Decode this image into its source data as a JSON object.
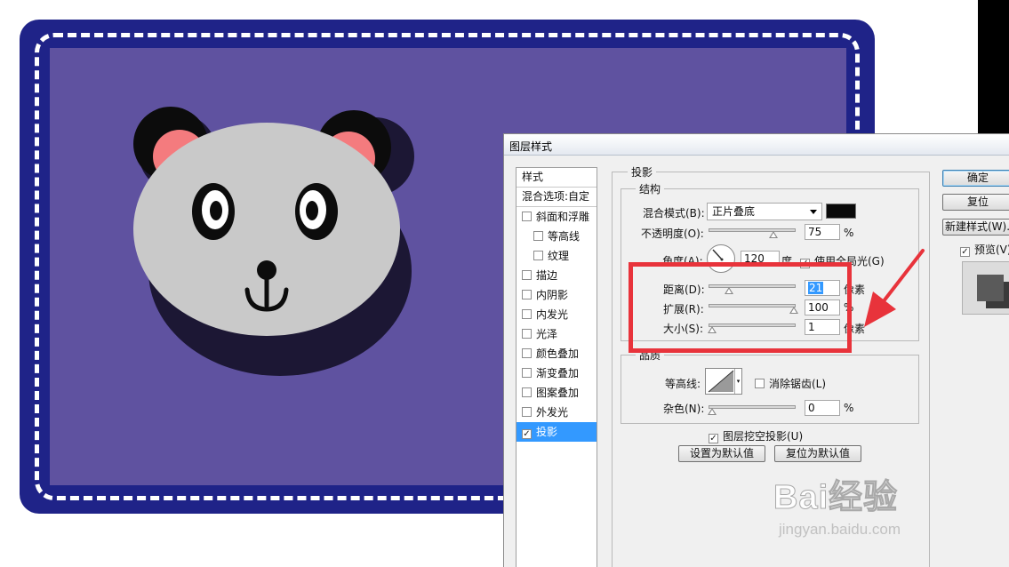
{
  "dialog": {
    "title": "图层样式",
    "styles_header": "样式",
    "blend_options": "混合选项:自定",
    "style_items": [
      {
        "label": "斜面和浮雕",
        "checked": false,
        "sub": false
      },
      {
        "label": "等高线",
        "checked": false,
        "sub": true
      },
      {
        "label": "纹理",
        "checked": false,
        "sub": true
      },
      {
        "label": "描边",
        "checked": false,
        "sub": false
      },
      {
        "label": "内阴影",
        "checked": false,
        "sub": false
      },
      {
        "label": "内发光",
        "checked": false,
        "sub": false
      },
      {
        "label": "光泽",
        "checked": false,
        "sub": false
      },
      {
        "label": "颜色叠加",
        "checked": false,
        "sub": false
      },
      {
        "label": "渐变叠加",
        "checked": false,
        "sub": false
      },
      {
        "label": "图案叠加",
        "checked": false,
        "sub": false
      },
      {
        "label": "外发光",
        "checked": false,
        "sub": false
      },
      {
        "label": "投影",
        "checked": true,
        "sub": false,
        "selected": true
      }
    ],
    "drop_shadow": {
      "section_title": "投影",
      "structure_title": "结构",
      "blend_mode_label": "混合模式(B):",
      "blend_mode_value": "正片叠底",
      "shadow_color": "#0a0a0a",
      "opacity_label": "不透明度(O):",
      "opacity_value": "75",
      "opacity_unit": "%",
      "angle_label": "角度(A):",
      "angle_value": "120",
      "angle_unit": "度",
      "global_light_label": "使用全局光(G)",
      "distance_label": "距离(D):",
      "distance_value": "21",
      "distance_unit": "像素",
      "spread_label": "扩展(R):",
      "spread_value": "100",
      "spread_unit": "%",
      "size_label": "大小(S):",
      "size_value": "1",
      "size_unit": "像素",
      "quality_title": "品质",
      "contour_label": "等高线:",
      "anti_alias_label": "消除锯齿(L)",
      "noise_label": "杂色(N):",
      "noise_value": "0",
      "noise_unit": "%",
      "knockout_label": "图层挖空投影(U)",
      "set_default_label": "设置为默认值",
      "reset_default_label": "复位为默认值"
    },
    "buttons": {
      "ok": "确定",
      "reset": "复位",
      "new_style": "新建样式(W)...",
      "preview": "预览(V)"
    }
  },
  "watermark": {
    "brand": "Bai经验",
    "url": "jingyan.baidu.com"
  },
  "colors": {
    "card_border": "#1f2388",
    "card_fill": "#5f52a0",
    "highlight_box": "#e8333b",
    "selection": "#3399ff"
  }
}
